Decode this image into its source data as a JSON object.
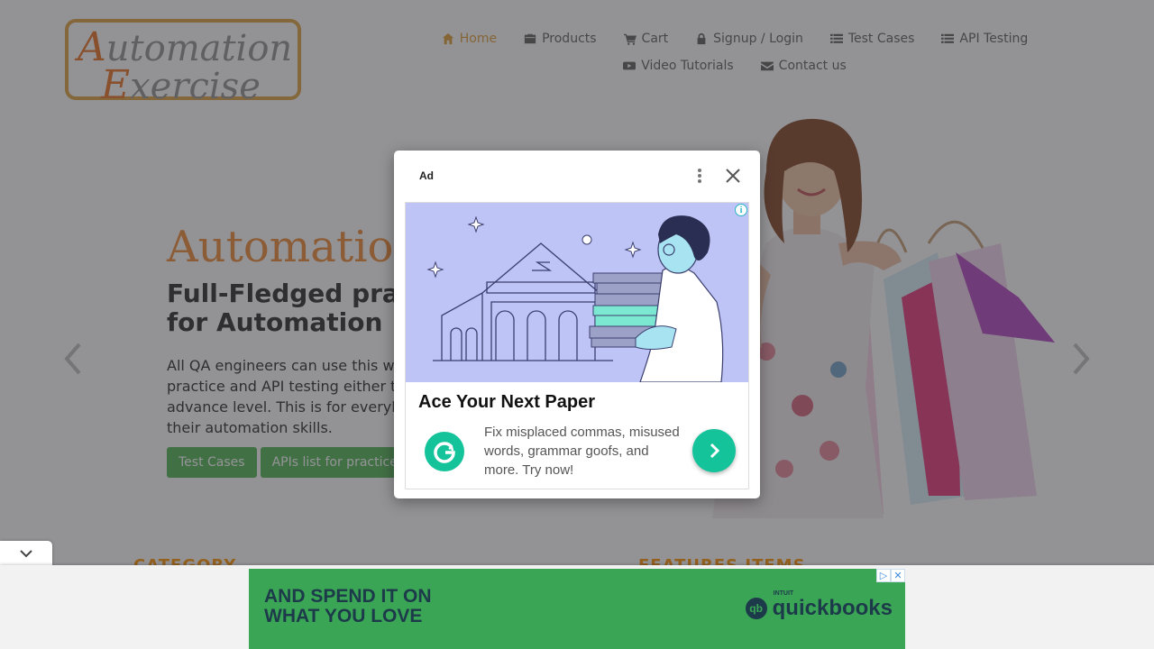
{
  "header": {
    "logo": {
      "line1_cap": "A",
      "line1_rest": "utomation",
      "line2_cap": "E",
      "line2_rest": "xercise"
    },
    "nav_row1": [
      {
        "label": "Home",
        "icon": "home-icon",
        "active": true
      },
      {
        "label": "Products",
        "icon": "briefcase-icon",
        "active": false
      },
      {
        "label": "Cart",
        "icon": "cart-icon",
        "active": false
      },
      {
        "label": "Signup / Login",
        "icon": "lock-icon",
        "active": false
      },
      {
        "label": "Test Cases",
        "icon": "list-icon",
        "active": false
      },
      {
        "label": "API Testing",
        "icon": "list-icon",
        "active": false
      }
    ],
    "nav_row2": [
      {
        "label": "Video Tutorials",
        "icon": "youtube-icon",
        "active": false
      },
      {
        "label": "Contact us",
        "icon": "envelope-icon",
        "active": false
      }
    ]
  },
  "hero": {
    "title": "Automatio",
    "subtitle": "Full-Fledged pra",
    "subtitle2": "for Automation",
    "desc": [
      "All QA engineers can use this w",
      "practice and API testing either t",
      "advance level. This is for everyl",
      "their automation skills."
    ],
    "btn_test_cases": "Test Cases",
    "btn_apis": "APIs list for practice"
  },
  "sections": {
    "category": "CATEGORY",
    "features": "FEATURES ITEMS"
  },
  "modal": {
    "ad_label": "Ad",
    "headline": "Ace Your Next Paper",
    "body": "Fix misplaced commas, misused words, grammar goofs, and more. Try now!",
    "info_glyph": "i"
  },
  "bottom_ad": {
    "line1": "AND SPEND IT ON",
    "line2": "WHAT YOU LOVE",
    "brand_small": "INTUIT",
    "brand": "quickbooks",
    "brand_mark": "qb",
    "adchoice_play": "▷",
    "adchoice_close": "✕"
  },
  "colors": {
    "accent": "#fe980f",
    "button": "#5cb85c",
    "overlay": "#28282e",
    "grammarly": "#15c39a",
    "quickbooks": "#3aa655"
  }
}
